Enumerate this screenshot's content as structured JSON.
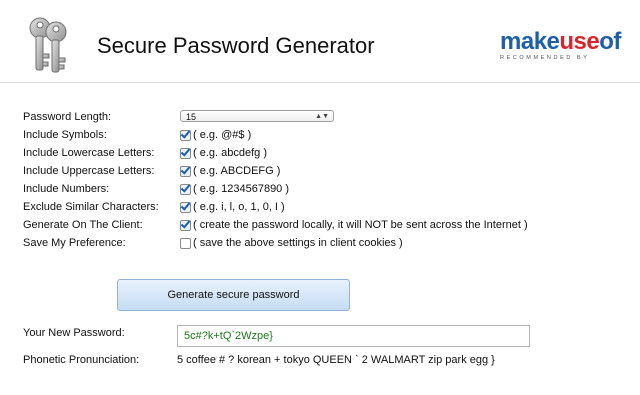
{
  "header": {
    "title": "Secure Password Generator",
    "logo": {
      "make": "make",
      "use": "use",
      "of": "of",
      "tagline": "RECOMMENDED BY"
    }
  },
  "form": {
    "length": {
      "label": "Password Length:",
      "value": "15"
    },
    "options": [
      {
        "label": "Include Symbols:",
        "checked": true,
        "hint": "( e.g. @#$ )"
      },
      {
        "label": "Include Lowercase Letters:",
        "checked": true,
        "hint": "( e.g. abcdefg )"
      },
      {
        "label": "Include Uppercase Letters:",
        "checked": true,
        "hint": "( e.g. ABCDEFG )"
      },
      {
        "label": "Include Numbers:",
        "checked": true,
        "hint": "( e.g. 1234567890 )"
      },
      {
        "label": "Exclude Similar Characters:",
        "checked": true,
        "hint": "( e.g. i, l, o, 1, 0, I )"
      },
      {
        "label": "Generate On The Client:",
        "checked": true,
        "hint": "( create the password locally, it will NOT be sent across the Internet )"
      },
      {
        "label": "Save My Preference:",
        "checked": false,
        "hint": "( save the above settings in client cookies )"
      }
    ],
    "generate_label": "Generate secure password"
  },
  "result": {
    "password_label": "Your New Password:",
    "password_value": "5c#?k+tQ`2Wzpe}",
    "phonetic_label": "Phonetic Pronunciation:",
    "phonetic_value": "5 coffee # ? korean + tokyo QUEEN ` 2 WALMART zip park egg }"
  },
  "colors": {
    "logo_blue": "#1d5fa8",
    "logo_red": "#d8262e",
    "password_green": "#1b7a1b",
    "check_blue": "#1a5fb4"
  }
}
